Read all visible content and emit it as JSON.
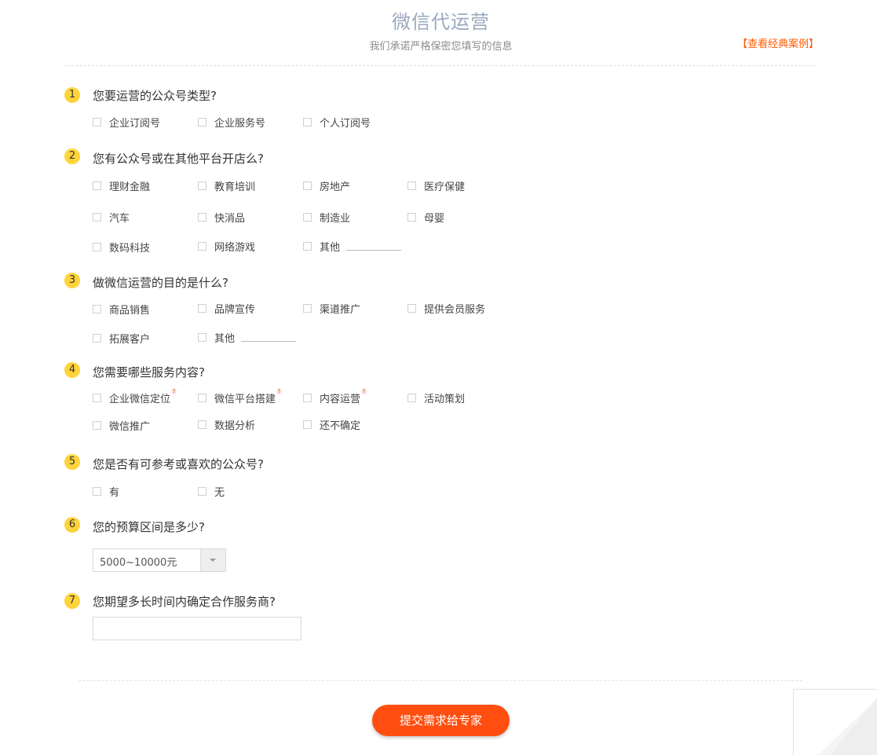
{
  "header": {
    "title": "微信代运营",
    "subtitle": "我们承诺严格保密您填写的信息",
    "case_link": "【查看经典案例】"
  },
  "questions": [
    {
      "number": "1",
      "title": "您要运营的公众号类型?",
      "options": [
        "企业订阅号",
        "企业服务号",
        "个人订阅号"
      ]
    },
    {
      "number": "2",
      "title": "您有公众号或在其他平台开店么?",
      "options": [
        "理财金融",
        "教育培训",
        "房地产",
        "医疗保健",
        "汽车",
        "快消品",
        "制造业",
        "母婴",
        "数码科技",
        "网络游戏",
        "其他"
      ]
    },
    {
      "number": "3",
      "title": "做微信运营的目的是什么?",
      "options": [
        "商品销售",
        "品牌宣传",
        "渠道推广",
        "提供会员服务",
        "拓展客户",
        "其他"
      ]
    },
    {
      "number": "4",
      "title": "您需要哪些服务内容?",
      "options": [
        "企业微信定位",
        "微信平台搭建",
        "内容运营",
        "活动策划",
        "微信推广",
        "数据分析",
        "还不确定"
      ],
      "help_mark": "?"
    },
    {
      "number": "5",
      "title": "您是否有可参考或喜欢的公众号?",
      "options": [
        "有",
        "无"
      ]
    },
    {
      "number": "6",
      "title": "您的预算区间是多少?",
      "select_value": "5000~10000元"
    },
    {
      "number": "7",
      "title": "您期望多长时间内确定合作服务商?",
      "input_value": ""
    }
  ],
  "submit_label": "提交需求给专家",
  "colors": {
    "accent": "#ff4e10",
    "link": "#ff5a00",
    "number_badge": "#ffd43b",
    "title": "#9aa8bf"
  }
}
